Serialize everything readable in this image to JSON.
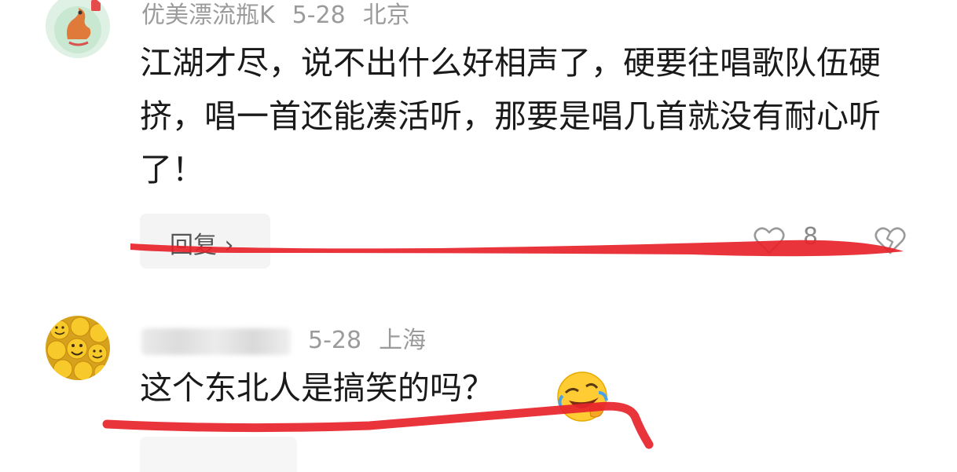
{
  "comments": [
    {
      "username": "优美漂流瓶K",
      "date": "5-28",
      "location": "北京",
      "text": "江湖才尽，说不出什么好相声了，硬要往唱歌队伍硬挤，唱一首还能凑活听，那要是唱几首就没有耐心听了！",
      "reply_label": "回复 ›",
      "like_count": "8"
    },
    {
      "date": "5-28",
      "location": "上海",
      "text": "这个东北人是搞笑的吗？"
    }
  ],
  "colors": {
    "marker": "#e8232b",
    "meta_text": "#9b9b9b",
    "body_text": "#1a1a1a"
  },
  "icons": [
    "dragon-avatar-icon",
    "smiley-avatar-icon",
    "heart-icon",
    "broken-heart-icon",
    "rolling-laughing-emoji-icon"
  ]
}
